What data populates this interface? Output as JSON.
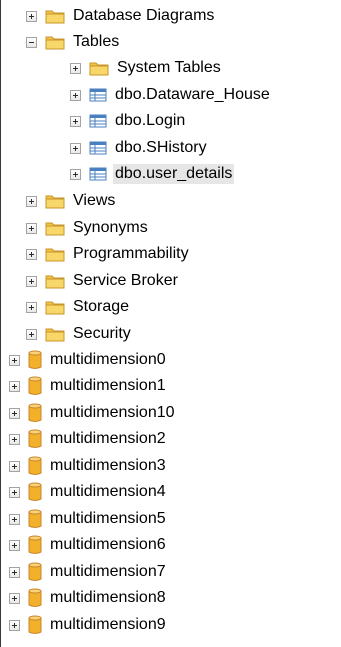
{
  "tree": {
    "database_diagrams": "Database Diagrams",
    "tables": {
      "label": "Tables",
      "children": [
        "System Tables",
        "dbo.Dataware_House",
        "dbo.Login",
        "dbo.SHistory",
        "dbo.user_details"
      ]
    },
    "folders": [
      "Views",
      "Synonyms",
      "Programmability",
      "Service Broker",
      "Storage",
      "Security"
    ],
    "databases": [
      "multidimension0",
      "multidimension1",
      "multidimension10",
      "multidimension2",
      "multidimension3",
      "multidimension4",
      "multidimension5",
      "multidimension6",
      "multidimension7",
      "multidimension8",
      "multidimension9"
    ],
    "selected_item": "dbo.user_details"
  },
  "colors": {
    "folder": "#f2c444",
    "folder_dark": "#c9952a",
    "table_icon": "#4a7fc0",
    "database_icon": "#f3b02b",
    "selection": "#e6e6e6"
  },
  "icons": {
    "folder": "folder-icon",
    "table": "table-icon",
    "database": "database-icon",
    "expand": "plus-expander-icon",
    "collapse": "minus-expander-icon"
  }
}
